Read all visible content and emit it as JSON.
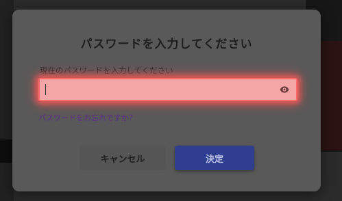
{
  "dialog": {
    "title": "パスワードを入力してください",
    "field_label": "現在のパスワードを入力してください",
    "password_value": "",
    "forgot_link": "パスワードをお忘れですか？",
    "cancel_label": "キャンセル",
    "ok_label": "決定",
    "icons": {
      "visibility_toggle": "eye-icon"
    }
  },
  "colors": {
    "dialog_background": "#595959",
    "input_error_glow": "#ff6a6a",
    "primary_button": "#2f3e8e",
    "link": "#5e2b8a"
  }
}
